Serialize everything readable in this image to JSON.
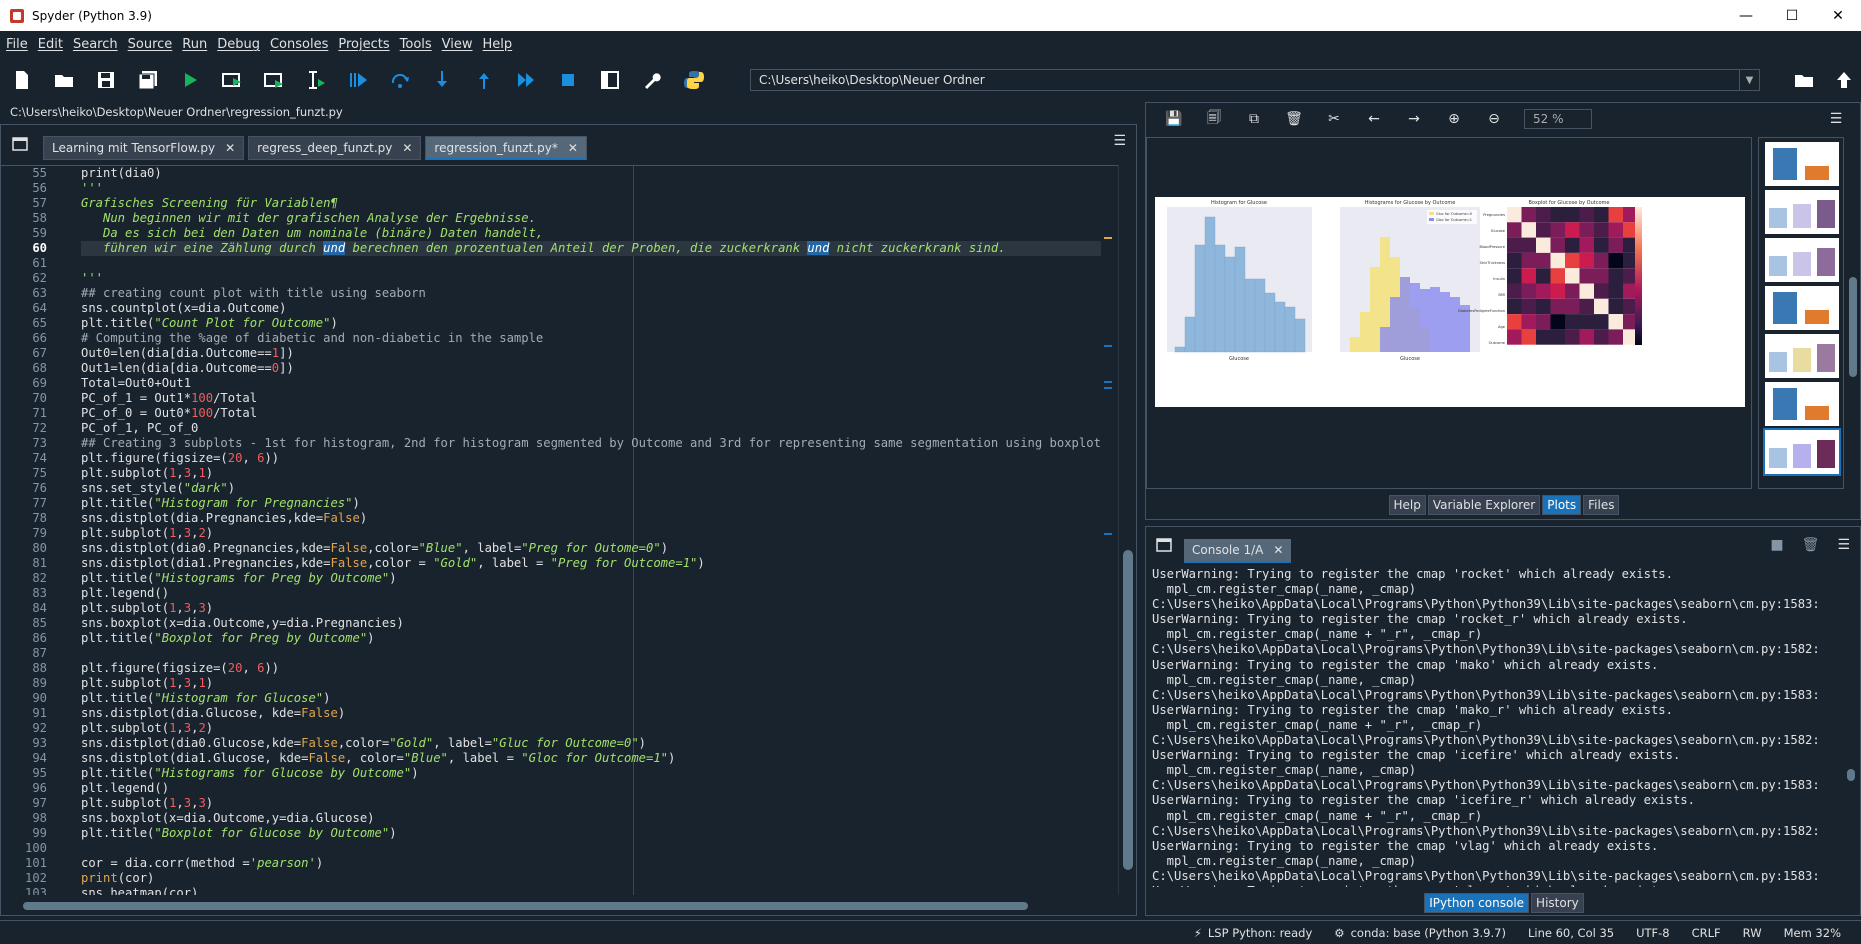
{
  "window": {
    "title": "Spyder (Python 3.9)",
    "controls": {
      "minimize": "—",
      "maximize": "☐",
      "close": "✕"
    }
  },
  "menu": [
    "File",
    "Edit",
    "Search",
    "Source",
    "Run",
    "Debug",
    "Consoles",
    "Projects",
    "Tools",
    "View",
    "Help"
  ],
  "toolbar": {
    "icons": [
      "new-file-icon",
      "open-file-icon",
      "save-icon",
      "save-all-icon",
      "run-icon",
      "run-cell-icon",
      "run-cell-advance-icon",
      "run-selection-icon",
      "debug-icon",
      "step-icon",
      "step-into-icon",
      "step-return-icon",
      "continue-icon",
      "stop-icon",
      "maximize-pane-icon",
      "preferences-icon",
      "python-path-icon"
    ],
    "working_directory": "C:\\Users\\heiko\\Desktop\\Neuer Ordner"
  },
  "editor": {
    "file_path": "C:\\Users\\heiko\\Desktop\\Neuer Ordner\\regression_funzt.py",
    "tabs": [
      {
        "label": "Learning mit TensorFlow.py",
        "active": false
      },
      {
        "label": "regress_deep_funzt.py",
        "active": false
      },
      {
        "label": "regression_funzt.py*",
        "active": true
      }
    ],
    "current_line": 60
  },
  "code": [
    {
      "n": "55",
      "html": "print(dia0)"
    },
    {
      "n": "56",
      "html": "<span class='doc'>'''</span>"
    },
    {
      "n": "57",
      "html": "<span class='doc'>Grafisches Screening für Variablen¶</span>"
    },
    {
      "n": "58",
      "html": "<span class='doc'>   Nun beginnen wir mit der grafischen Analyse der Ergebnisse.</span>"
    },
    {
      "n": "59",
      "html": "<span class='doc'>   Da es sich bei den Daten um nominale (binäre) Daten handelt,</span>"
    },
    {
      "n": "60",
      "html": "<span class='doc'>   führen wir eine Zählung durch <span class='hl'>und</span> berechnen den prozentualen Anteil der Proben, die zuckerkrank <span class='hl'>und</span> nicht zuckerkrank sind.</span>"
    },
    {
      "n": "61",
      "html": ""
    },
    {
      "n": "62",
      "html": "<span class='doc'>'''</span>"
    },
    {
      "n": "63",
      "html": "<span class='cmt'>## creating count plot with title using seaborn</span>"
    },
    {
      "n": "64",
      "html": "sns.countplot(x=dia.Outcome)"
    },
    {
      "n": "65",
      "html": "plt.title(<span class='str'>\"Count Plot for Outcome\"</span>)"
    },
    {
      "n": "66",
      "html": "<span class='cmt'># Computing the %age of diabetic and non-diabetic in the sample</span>"
    },
    {
      "n": "67",
      "html": "Out0=len(dia[dia.Outcome==<span class='num-lit'>1</span>])"
    },
    {
      "n": "68",
      "html": "Out1=len(dia[dia.Outcome==<span class='num-lit'>0</span>])"
    },
    {
      "n": "69",
      "html": "Total=Out0+Out1"
    },
    {
      "n": "70",
      "html": "PC_of_1 = Out1*<span class='num-lit'>100</span>/Total"
    },
    {
      "n": "71",
      "html": "PC_of_0 = Out0*<span class='num-lit'>100</span>/Total"
    },
    {
      "n": "72",
      "html": "PC_of_1, PC_of_0"
    },
    {
      "n": "73",
      "html": "<span class='cmt'>## Creating 3 subplots - 1st for histogram, 2nd for histogram segmented by Outcome and 3rd for representing same segmentation using boxplot</span>"
    },
    {
      "n": "74",
      "html": "plt.figure(figsize=(<span class='num-lit'>20</span>, <span class='num-lit'>6</span>))"
    },
    {
      "n": "75",
      "html": "plt.subplot(<span class='num-lit'>1</span>,<span class='num-lit'>3</span>,<span class='num-lit'>1</span>)"
    },
    {
      "n": "76",
      "html": "sns.set_style(<span class='str'>\"dark\"</span>)"
    },
    {
      "n": "77",
      "html": "plt.title(<span class='str'>\"Histogram for Pregnancies\"</span>)"
    },
    {
      "n": "78",
      "html": "sns.distplot(dia.Pregnancies,kde=<span class='kw'>False</span>)"
    },
    {
      "n": "79",
      "html": "plt.subplot(<span class='num-lit'>1</span>,<span class='num-lit'>3</span>,<span class='num-lit'>2</span>)"
    },
    {
      "n": "80",
      "html": "sns.distplot(dia0.Pregnancies,kde=<span class='kw'>False</span>,color=<span class='str'>\"Blue\"</span>, label=<span class='str'>\"Preg for Outome=0\"</span>)"
    },
    {
      "n": "81",
      "html": "sns.distplot(dia1.Pregnancies,kde=<span class='kw'>False</span>,color = <span class='str'>\"Gold\"</span>, label = <span class='str'>\"Preg for Outcome=1\"</span>)"
    },
    {
      "n": "82",
      "html": "plt.title(<span class='str'>\"Histograms for Preg by Outcome\"</span>)"
    },
    {
      "n": "83",
      "html": "plt.legend()"
    },
    {
      "n": "84",
      "html": "plt.subplot(<span class='num-lit'>1</span>,<span class='num-lit'>3</span>,<span class='num-lit'>3</span>)"
    },
    {
      "n": "85",
      "html": "sns.boxplot(x=dia.Outcome,y=dia.Pregnancies)"
    },
    {
      "n": "86",
      "html": "plt.title(<span class='str'>\"Boxplot for Preg by Outcome\"</span>)"
    },
    {
      "n": "87",
      "html": ""
    },
    {
      "n": "88",
      "html": "plt.figure(figsize=(<span class='num-lit'>20</span>, <span class='num-lit'>6</span>))"
    },
    {
      "n": "89",
      "html": "plt.subplot(<span class='num-lit'>1</span>,<span class='num-lit'>3</span>,<span class='num-lit'>1</span>)"
    },
    {
      "n": "90",
      "html": "plt.title(<span class='str'>\"Histogram for Glucose\"</span>)"
    },
    {
      "n": "91",
      "html": "sns.distplot(dia.Glucose, kde=<span class='kw'>False</span>)"
    },
    {
      "n": "92",
      "html": "plt.subplot(<span class='num-lit'>1</span>,<span class='num-lit'>3</span>,<span class='num-lit'>2</span>)"
    },
    {
      "n": "93",
      "html": "sns.distplot(dia0.Glucose,kde=<span class='kw'>False</span>,color=<span class='str'>\"Gold\"</span>, label=<span class='str'>\"Gluc for Outcome=0\"</span>)"
    },
    {
      "n": "94",
      "html": "sns.distplot(dia1.Glucose, kde=<span class='kw'>False</span>, color=<span class='str'>\"Blue\"</span>, label = <span class='str'>\"Gloc for Outcome=1\"</span>)"
    },
    {
      "n": "95",
      "html": "plt.title(<span class='str'>\"Histograms for Glucose by Outcome\"</span>)"
    },
    {
      "n": "96",
      "html": "plt.legend()"
    },
    {
      "n": "97",
      "html": "plt.subplot(<span class='num-lit'>1</span>,<span class='num-lit'>3</span>,<span class='num-lit'>3</span>)"
    },
    {
      "n": "98",
      "html": "sns.boxplot(x=dia.Outcome,y=dia.Glucose)"
    },
    {
      "n": "99",
      "html": "plt.title(<span class='str'>\"Boxplot for Glucose by Outcome\"</span>)"
    },
    {
      "n": "100",
      "html": ""
    },
    {
      "n": "101",
      "html": "cor = dia.corr(method =<span class='str'>'pearson'</span>)"
    },
    {
      "n": "102",
      "html": "<span class='kw'>print</span>(cor)"
    },
    {
      "n": "103",
      "html": "sns.heatmap(cor)"
    }
  ],
  "plots": {
    "zoom": "52 %",
    "figure": {
      "panel1_title": "Histogram for Glucose",
      "panel2_title": "Histograms for Glucose by Outcome",
      "panel3_title": "Boxplot for Glucose by Outcome",
      "legend": [
        "Gluc for Outcome=0",
        "Gloc for Outcome=1"
      ],
      "xlabel": "Glucose",
      "heat_rows": [
        "Pregnancies",
        "Glucose",
        "BloodPressure",
        "SkinThickness",
        "Insulin",
        "BMI",
        "DiabetesPedigreeFunction",
        "Age",
        "Outcome"
      ]
    },
    "pane_tabs": [
      "Help",
      "Variable Explorer",
      "Plots",
      "Files"
    ],
    "active_tab": "Plots"
  },
  "console": {
    "tab_label": "Console 1/A",
    "lines": [
      "UserWarning: Trying to register the cmap 'rocket' which already exists.",
      "  mpl_cm.register_cmap(_name, _cmap)",
      "C:\\Users\\heiko\\AppData\\Local\\Programs\\Python\\Python39\\Lib\\site-packages\\seaborn\\cm.py:1583:",
      "UserWarning: Trying to register the cmap 'rocket_r' which already exists.",
      "  mpl_cm.register_cmap(_name + \"_r\", _cmap_r)",
      "C:\\Users\\heiko\\AppData\\Local\\Programs\\Python\\Python39\\Lib\\site-packages\\seaborn\\cm.py:1582:",
      "UserWarning: Trying to register the cmap 'mako' which already exists.",
      "  mpl_cm.register_cmap(_name, _cmap)",
      "C:\\Users\\heiko\\AppData\\Local\\Programs\\Python\\Python39\\Lib\\site-packages\\seaborn\\cm.py:1583:",
      "UserWarning: Trying to register the cmap 'mako_r' which already exists.",
      "  mpl_cm.register_cmap(_name + \"_r\", _cmap_r)",
      "C:\\Users\\heiko\\AppData\\Local\\Programs\\Python\\Python39\\Lib\\site-packages\\seaborn\\cm.py:1582:",
      "UserWarning: Trying to register the cmap 'icefire' which already exists.",
      "  mpl_cm.register_cmap(_name, _cmap)",
      "C:\\Users\\heiko\\AppData\\Local\\Programs\\Python\\Python39\\Lib\\site-packages\\seaborn\\cm.py:1583:",
      "UserWarning: Trying to register the cmap 'icefire_r' which already exists.",
      "  mpl_cm.register_cmap(_name + \"_r\", _cmap_r)",
      "C:\\Users\\heiko\\AppData\\Local\\Programs\\Python\\Python39\\Lib\\site-packages\\seaborn\\cm.py:1582:",
      "UserWarning: Trying to register the cmap 'vlag' which already exists.",
      "  mpl_cm.register_cmap(_name, _cmap)",
      "C:\\Users\\heiko\\AppData\\Local\\Programs\\Python\\Python39\\Lib\\site-packages\\seaborn\\cm.py:1583:",
      "UserWarning: Trying to register the cmap 'vlag_r' which already exists."
    ],
    "pane_tabs": [
      "IPython console",
      "History"
    ],
    "active_tab": "IPython console"
  },
  "status": {
    "lsp": "LSP Python: ready",
    "conda": "conda: base (Python 3.9.7)",
    "cursor": "Line 60, Col 35",
    "encoding": "UTF-8",
    "eol": "CRLF",
    "rw": "RW",
    "mem": "Mem 32%"
  },
  "colors": {
    "bg": "#19232d",
    "accent": "#1a72bb",
    "border": "#455364",
    "text": "#e0e1e3"
  }
}
